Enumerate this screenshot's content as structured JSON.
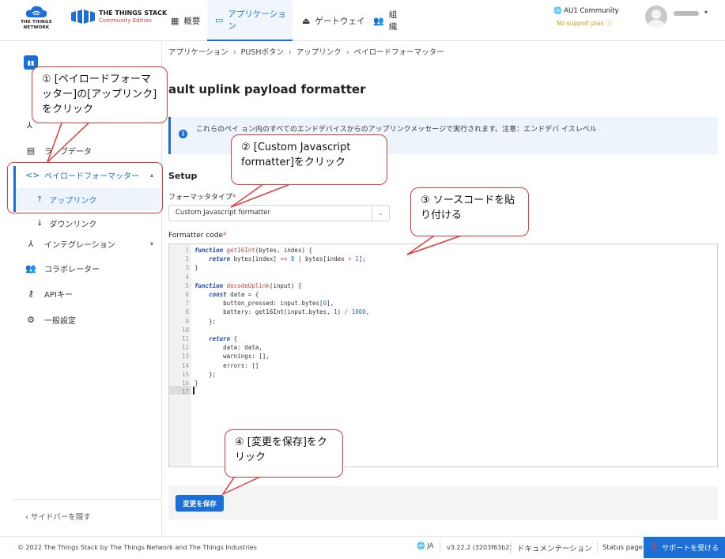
{
  "header": {
    "ttn_logo_text": "THE THINGS NETWORK",
    "tts_title": "THE THINGS STACK",
    "tts_subtitle": "Community Edition",
    "nav": [
      {
        "label": "概要"
      },
      {
        "label": "アプリケーション"
      },
      {
        "label": "ゲートウェイ"
      },
      {
        "label": "組織"
      }
    ],
    "network_name": "AU1 Community",
    "support_plan": "No support plan"
  },
  "breadcrumb": [
    "アプリケーション",
    "PUSHボタン",
    "アップリンク",
    "ペイロードフォーマッター"
  ],
  "sidebar": {
    "items": [
      {
        "label": "ライブデータ"
      },
      {
        "label": "ペイロードフォーマッター"
      },
      {
        "label": "アップリンク"
      },
      {
        "label": "ダウンリンク"
      },
      {
        "label": "インテグレーション"
      },
      {
        "label": "コラボレーター"
      },
      {
        "label": "APIキー"
      },
      {
        "label": "一般設定"
      }
    ],
    "hide_label": "サイドバーを隠す"
  },
  "main": {
    "title": "ault uplink payload formatter",
    "info_text": "これらのペイ                                                   ョン内のすべてのエンドデバイスからのアップリンクメッセージで実行されます。注意：エンドデバ イスレベル",
    "setup_title": "Setup",
    "formatter_type_label": "フォーマッタタイプ",
    "formatter_type_value": "Custom Javascript formatter",
    "formatter_code_label": "Formatter code",
    "save_label": "変更を保存"
  },
  "footer": {
    "copyright": "© 2022 The Things Stack by The Things Network and The Things Industries",
    "lang": "JA",
    "version": "v3.22.2 (3203f63b2)",
    "docs": "ドキュメンテーション",
    "status": "Status page",
    "support": "サポートを受ける"
  },
  "callouts": [
    {
      "text": "① [ペイロードフォーマッター]の[アップリンク]をクリック"
    },
    {
      "text": "② [Custom Javascript formatter]をクリック"
    },
    {
      "text": "③ ソースコードを貼り付ける"
    },
    {
      "text": "④ [変更を保存]をクリック"
    }
  ],
  "colors": {
    "accent": "#1c6fd6",
    "callout": "#e03b3b"
  }
}
